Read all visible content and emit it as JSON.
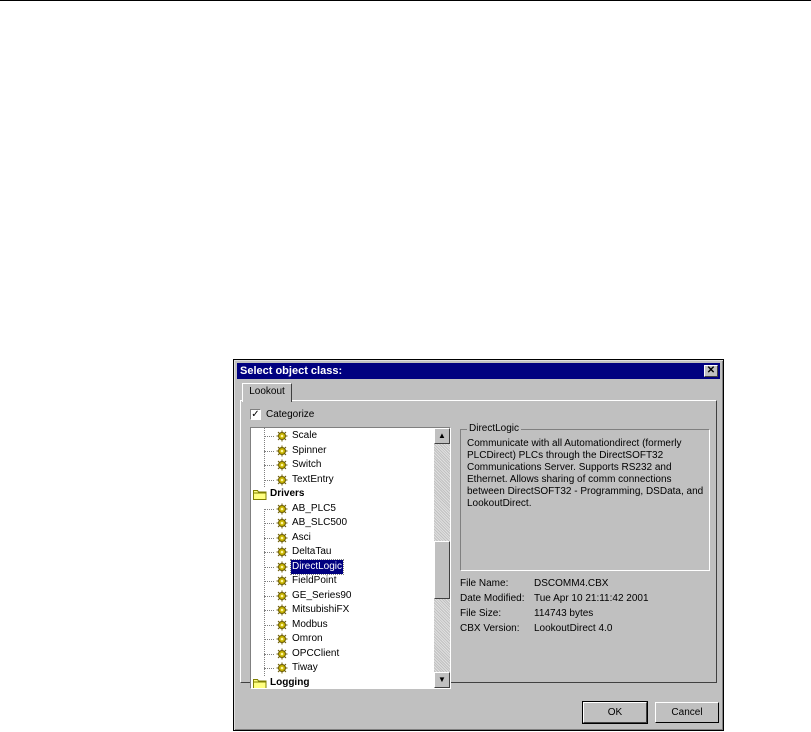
{
  "dialog": {
    "title": "Select object class:",
    "close_glyph": "✕",
    "tab_label": "Lookout",
    "categorize_label": "Categorize",
    "categorize_checked": "✓"
  },
  "tree": {
    "items": [
      {
        "label": "Scale",
        "type": "object"
      },
      {
        "label": "Spinner",
        "type": "object"
      },
      {
        "label": "Switch",
        "type": "object"
      },
      {
        "label": "TextEntry",
        "type": "object"
      },
      {
        "label": "Drivers",
        "type": "folder"
      },
      {
        "label": "AB_PLC5",
        "type": "object"
      },
      {
        "label": "AB_SLC500",
        "type": "object"
      },
      {
        "label": "Asci",
        "type": "object"
      },
      {
        "label": "DeltaTau",
        "type": "object"
      },
      {
        "label": "DirectLogic",
        "type": "object",
        "selected": true
      },
      {
        "label": "FieldPoint",
        "type": "object"
      },
      {
        "label": "GE_Series90",
        "type": "object"
      },
      {
        "label": "MitsubishiFX",
        "type": "object"
      },
      {
        "label": "Modbus",
        "type": "object"
      },
      {
        "label": "Omron",
        "type": "object"
      },
      {
        "label": "OPCClient",
        "type": "object"
      },
      {
        "label": "Tiway",
        "type": "object"
      },
      {
        "label": "Logging",
        "type": "folder"
      }
    ],
    "scroll_up_glyph": "▲",
    "scroll_down_glyph": "▼"
  },
  "details": {
    "group_title": "DirectLogic",
    "description": "Communicate with all Automationdirect (formerly PLCDirect) PLCs through the DirectSOFT32 Communications Server. Supports RS232 and Ethernet. Allows sharing of comm connections between DirectSOFT32 - Programming, DSData, and LookoutDirect.",
    "file_name_label": "File Name:",
    "file_name": "DSCOMM4.CBX",
    "date_modified_label": "Date Modified:",
    "date_modified": "Tue Apr 10 21:11:42 2001",
    "file_size_label": "File Size:",
    "file_size": "114743 bytes",
    "cbx_version_label": "CBX Version:",
    "cbx_version": "LookoutDirect 4.0"
  },
  "buttons": {
    "ok": "OK",
    "cancel": "Cancel"
  }
}
